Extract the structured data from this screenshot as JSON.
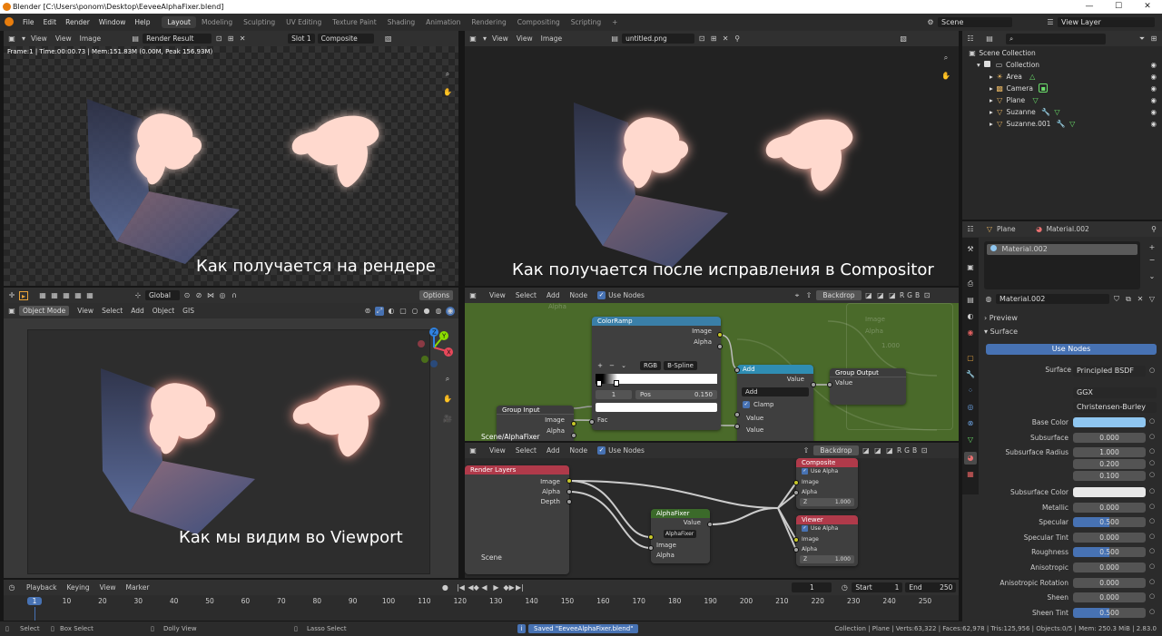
{
  "window": {
    "title": "Blender [C:\\Users\\ponom\\Desktop\\EeveeAlphaFixer.blend]",
    "controls": [
      "—",
      "☐",
      "✕"
    ]
  },
  "menubar": {
    "menus": [
      "File",
      "Edit",
      "Render",
      "Window",
      "Help"
    ],
    "workspaces": [
      "Layout",
      "Modeling",
      "Sculpting",
      "UV Editing",
      "Texture Paint",
      "Shading",
      "Animation",
      "Rendering",
      "Compositing",
      "Scripting"
    ],
    "active_workspace": "Layout",
    "add_tab": "+",
    "scene": "Scene",
    "view_layer": "View Layer"
  },
  "image_editor_left": {
    "view": "View",
    "view2": "View",
    "image": "Image",
    "image_name": "Render Result",
    "slot": "Slot 1",
    "pass": "Composite",
    "info": "Frame:1 | Time:00:00.73 | Mem:151.83M (0.00M, Peak 156.93M)",
    "caption": "Как получается на рендере"
  },
  "image_editor_right": {
    "view": "View",
    "view2": "View",
    "image": "Image",
    "image_name": "untitled.png",
    "caption": "Как получается после исправления в Compositor"
  },
  "viewport": {
    "orientation": "Global",
    "options": "Options",
    "mode": "Object Mode",
    "menus": [
      "View",
      "Select",
      "Add",
      "Object",
      "GIS"
    ],
    "caption": "Как мы видим во Viewport",
    "gizmo": {
      "x": "X",
      "y": "Y",
      "z": "Z"
    }
  },
  "node_group_editor": {
    "menus": [
      "View",
      "Select",
      "Add",
      "Node"
    ],
    "use_nodes": "Use Nodes",
    "backdrop": "Backdrop",
    "channels": [
      "R",
      "G",
      "B"
    ],
    "color_ramp": {
      "title": "ColorRamp",
      "out_image": "Image",
      "out_alpha": "Alpha",
      "mode": "RGB",
      "interp": "B-Spline",
      "index": "1",
      "pos_label": "Pos",
      "pos_value": "0.150",
      "in_fac": "Fac",
      "buttons": [
        "+",
        "−",
        "⌄"
      ]
    },
    "add_node": {
      "title": "Add",
      "out_value": "Value",
      "operation": "Add",
      "clamp": "Clamp",
      "in_value1": "Value",
      "in_value2": "Value"
    },
    "group_output": {
      "title": "Group Output",
      "in_value": "Value"
    },
    "group_input": {
      "title": "Group Input",
      "out_image": "Image",
      "out_alpha": "Alpha"
    },
    "breadcrumb": "Scene/AlphaFixer",
    "ghost": {
      "image": "Image",
      "alpha": "Alpha",
      "alpha2": "Alpha",
      "val": "1.000",
      "fac": "Fac"
    }
  },
  "compositor_editor": {
    "menus": [
      "View",
      "Select",
      "Add",
      "Node"
    ],
    "use_nodes": "Use Nodes",
    "backdrop": "Backdrop",
    "channels": [
      "R",
      "G",
      "B"
    ],
    "render_layers": {
      "title": "Render Layers",
      "out_image": "Image",
      "out_alpha": "Alpha",
      "out_depth": "Depth",
      "scene": "Scene"
    },
    "alpha_fixer": {
      "title": "AlphaFixer",
      "out_value": "Value",
      "group": "AlphaFixer",
      "in_image": "Image",
      "in_alpha": "Alpha"
    },
    "composite": {
      "title": "Composite",
      "use_alpha": "Use Alpha",
      "image": "Image",
      "alpha": "Alpha",
      "z": "Z",
      "z_val": "1.000"
    },
    "viewer": {
      "title": "Viewer",
      "use_alpha": "Use Alpha",
      "image": "Image",
      "alpha": "Alpha",
      "z": "Z",
      "z_val": "1.000"
    }
  },
  "timeline": {
    "menus": [
      "Playback",
      "Keying",
      "View",
      "Marker"
    ],
    "current_frame": "1",
    "start_label": "Start",
    "start": "1",
    "end_label": "End",
    "end": "250",
    "ticks": [
      "1",
      "10",
      "20",
      "30",
      "40",
      "50",
      "60",
      "70",
      "80",
      "90",
      "100",
      "110",
      "120",
      "130",
      "140",
      "150",
      "160",
      "170",
      "180",
      "190",
      "200",
      "210",
      "220",
      "230",
      "240",
      "250"
    ],
    "playback_controls": [
      "●",
      "|◀",
      "◀◆",
      "◀",
      "▶",
      "◆▶",
      "▶|"
    ]
  },
  "outliner": {
    "search_placeholder": "",
    "root": "Scene Collection",
    "collection": "Collection",
    "items": [
      "Area",
      "Camera",
      "Plane",
      "Suzanne",
      "Suzanne.001"
    ]
  },
  "properties": {
    "object": "Plane",
    "material_header": "Material.002",
    "slot_item": "Material.002",
    "material_field": "Material.002",
    "preview": "Preview",
    "surface_section": "Surface",
    "use_nodes_btn": "Use Nodes",
    "surface_label": "Surface",
    "surface_value": "Principled BSDF",
    "distribution": "GGX",
    "subsurface_method": "Christensen-Burley",
    "rows": [
      {
        "label": "Base Color",
        "value": "",
        "type": "color",
        "color": "#8fc6f0"
      },
      {
        "label": "Subsurface",
        "value": "0.000",
        "type": "num"
      },
      {
        "label": "Subsurface Radius",
        "value": "1.000",
        "type": "num"
      },
      {
        "label": "",
        "value": "0.200",
        "type": "num"
      },
      {
        "label": "",
        "value": "0.100",
        "type": "num"
      },
      {
        "label": "Subsurface Color",
        "value": "",
        "type": "color",
        "color": "#e8e8e8"
      },
      {
        "label": "Metallic",
        "value": "0.000",
        "type": "num"
      },
      {
        "label": "Specular",
        "value": "0.500",
        "type": "bar"
      },
      {
        "label": "Specular Tint",
        "value": "0.000",
        "type": "num"
      },
      {
        "label": "Roughness",
        "value": "0.500",
        "type": "bar"
      },
      {
        "label": "Anisotropic",
        "value": "0.000",
        "type": "num"
      },
      {
        "label": "Anisotropic Rotation",
        "value": "0.000",
        "type": "num"
      },
      {
        "label": "Sheen",
        "value": "0.000",
        "type": "num"
      },
      {
        "label": "Sheen Tint",
        "value": "0.500",
        "type": "bar"
      }
    ]
  },
  "statusbar": {
    "select": "Select",
    "box_select": "Box Select",
    "dolly": "Dolly View",
    "lasso": "Lasso Select",
    "saved": "Saved \"EeveeAlphaFixer.blend\"",
    "stats": "Collection | Plane | Verts:63,322 | Faces:62,978 | Tris:125,956 | Objects:0/5 | Mem: 250.3 MiB | 2.83.0"
  },
  "colors": {
    "accent": "#4772b3",
    "node_green_bg": "#4a6a2a",
    "glow": "#ffd6cc"
  }
}
